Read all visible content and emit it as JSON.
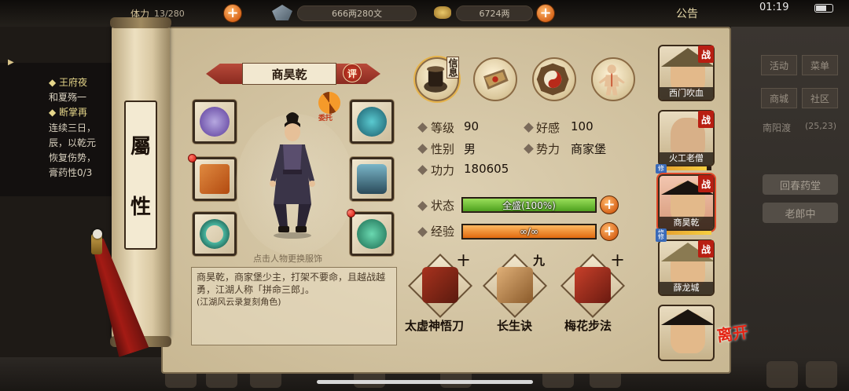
{
  "topbar": {
    "stamina_label": "体力",
    "stamina_value": "13/280",
    "coins_value": "666两280文",
    "silver_value": "6724两",
    "notice": "公告",
    "clock": "01:19"
  },
  "quest": {
    "lines": [
      {
        "text": "◆ 王府夜",
        "highlight": true
      },
      {
        "text": "和夏殇一",
        "highlight": false
      },
      {
        "text": "◆ 断掌再",
        "highlight": true
      },
      {
        "text": "连续三日，",
        "highlight": false
      },
      {
        "text": "辰，以乾元",
        "highlight": false
      },
      {
        "text": "恢复伤势，",
        "highlight": false
      },
      {
        "text": "膏药性0/3",
        "highlight": false
      }
    ]
  },
  "world": {
    "buttons": [
      "活动",
      "菜单",
      "商城",
      "社区"
    ],
    "location": "南阳渡",
    "coords": "(25,23)",
    "pill1": "回春药堂",
    "pill2": "老郎中"
  },
  "scroll": {
    "title_top": "屬",
    "title_bottom": "性"
  },
  "character": {
    "name": "商昊乾",
    "rate_badge": "评",
    "entrust": "委托",
    "hint": "点击人物更换服饰",
    "description": "商昊乾，商家堡少主，打架不要命，且越战越勇，江湖人称「拼命三郎」。",
    "description_sub": "(江湖风云录复刻角色)"
  },
  "tabs": {
    "info_label": "信息",
    "items": [
      "info-tab",
      "bag-tab",
      "bagua-tab",
      "meridian-tab"
    ]
  },
  "stats": {
    "level_label": "等级",
    "level_value": "90",
    "favor_label": "好感",
    "favor_value": "100",
    "gender_label": "性别",
    "gender_value": "男",
    "faction_label": "势力",
    "faction_value": "商家堡",
    "power_label": "功力",
    "power_value": "180605",
    "state_label": "状态",
    "state_text": "全盛(100%)",
    "state_fraction": 1.0,
    "exp_label": "经验",
    "exp_text": "∞/∞",
    "exp_fraction": 1.0
  },
  "skills": [
    {
      "name": "太虚神悟刀",
      "level": "十"
    },
    {
      "name": "长生诀",
      "level": "九"
    },
    {
      "name": "梅花步法",
      "level": "十"
    }
  ],
  "party": [
    {
      "name": "西门吹血",
      "tag": "战"
    },
    {
      "name": "火工老僧",
      "tag": "战",
      "cultivate": "修"
    },
    {
      "name": "商昊乾",
      "tag": "战",
      "cultivate": "修"
    },
    {
      "name": "薛龙城",
      "tag": "战",
      "cultivate": "修"
    },
    {
      "name": "",
      "tag": ""
    }
  ],
  "leave_label": "离开",
  "colors": {
    "accent": "#d9671c",
    "state_bar": "#4ea01e",
    "exp_bar": "#e06a10",
    "battle_tag": "#b81e12"
  }
}
